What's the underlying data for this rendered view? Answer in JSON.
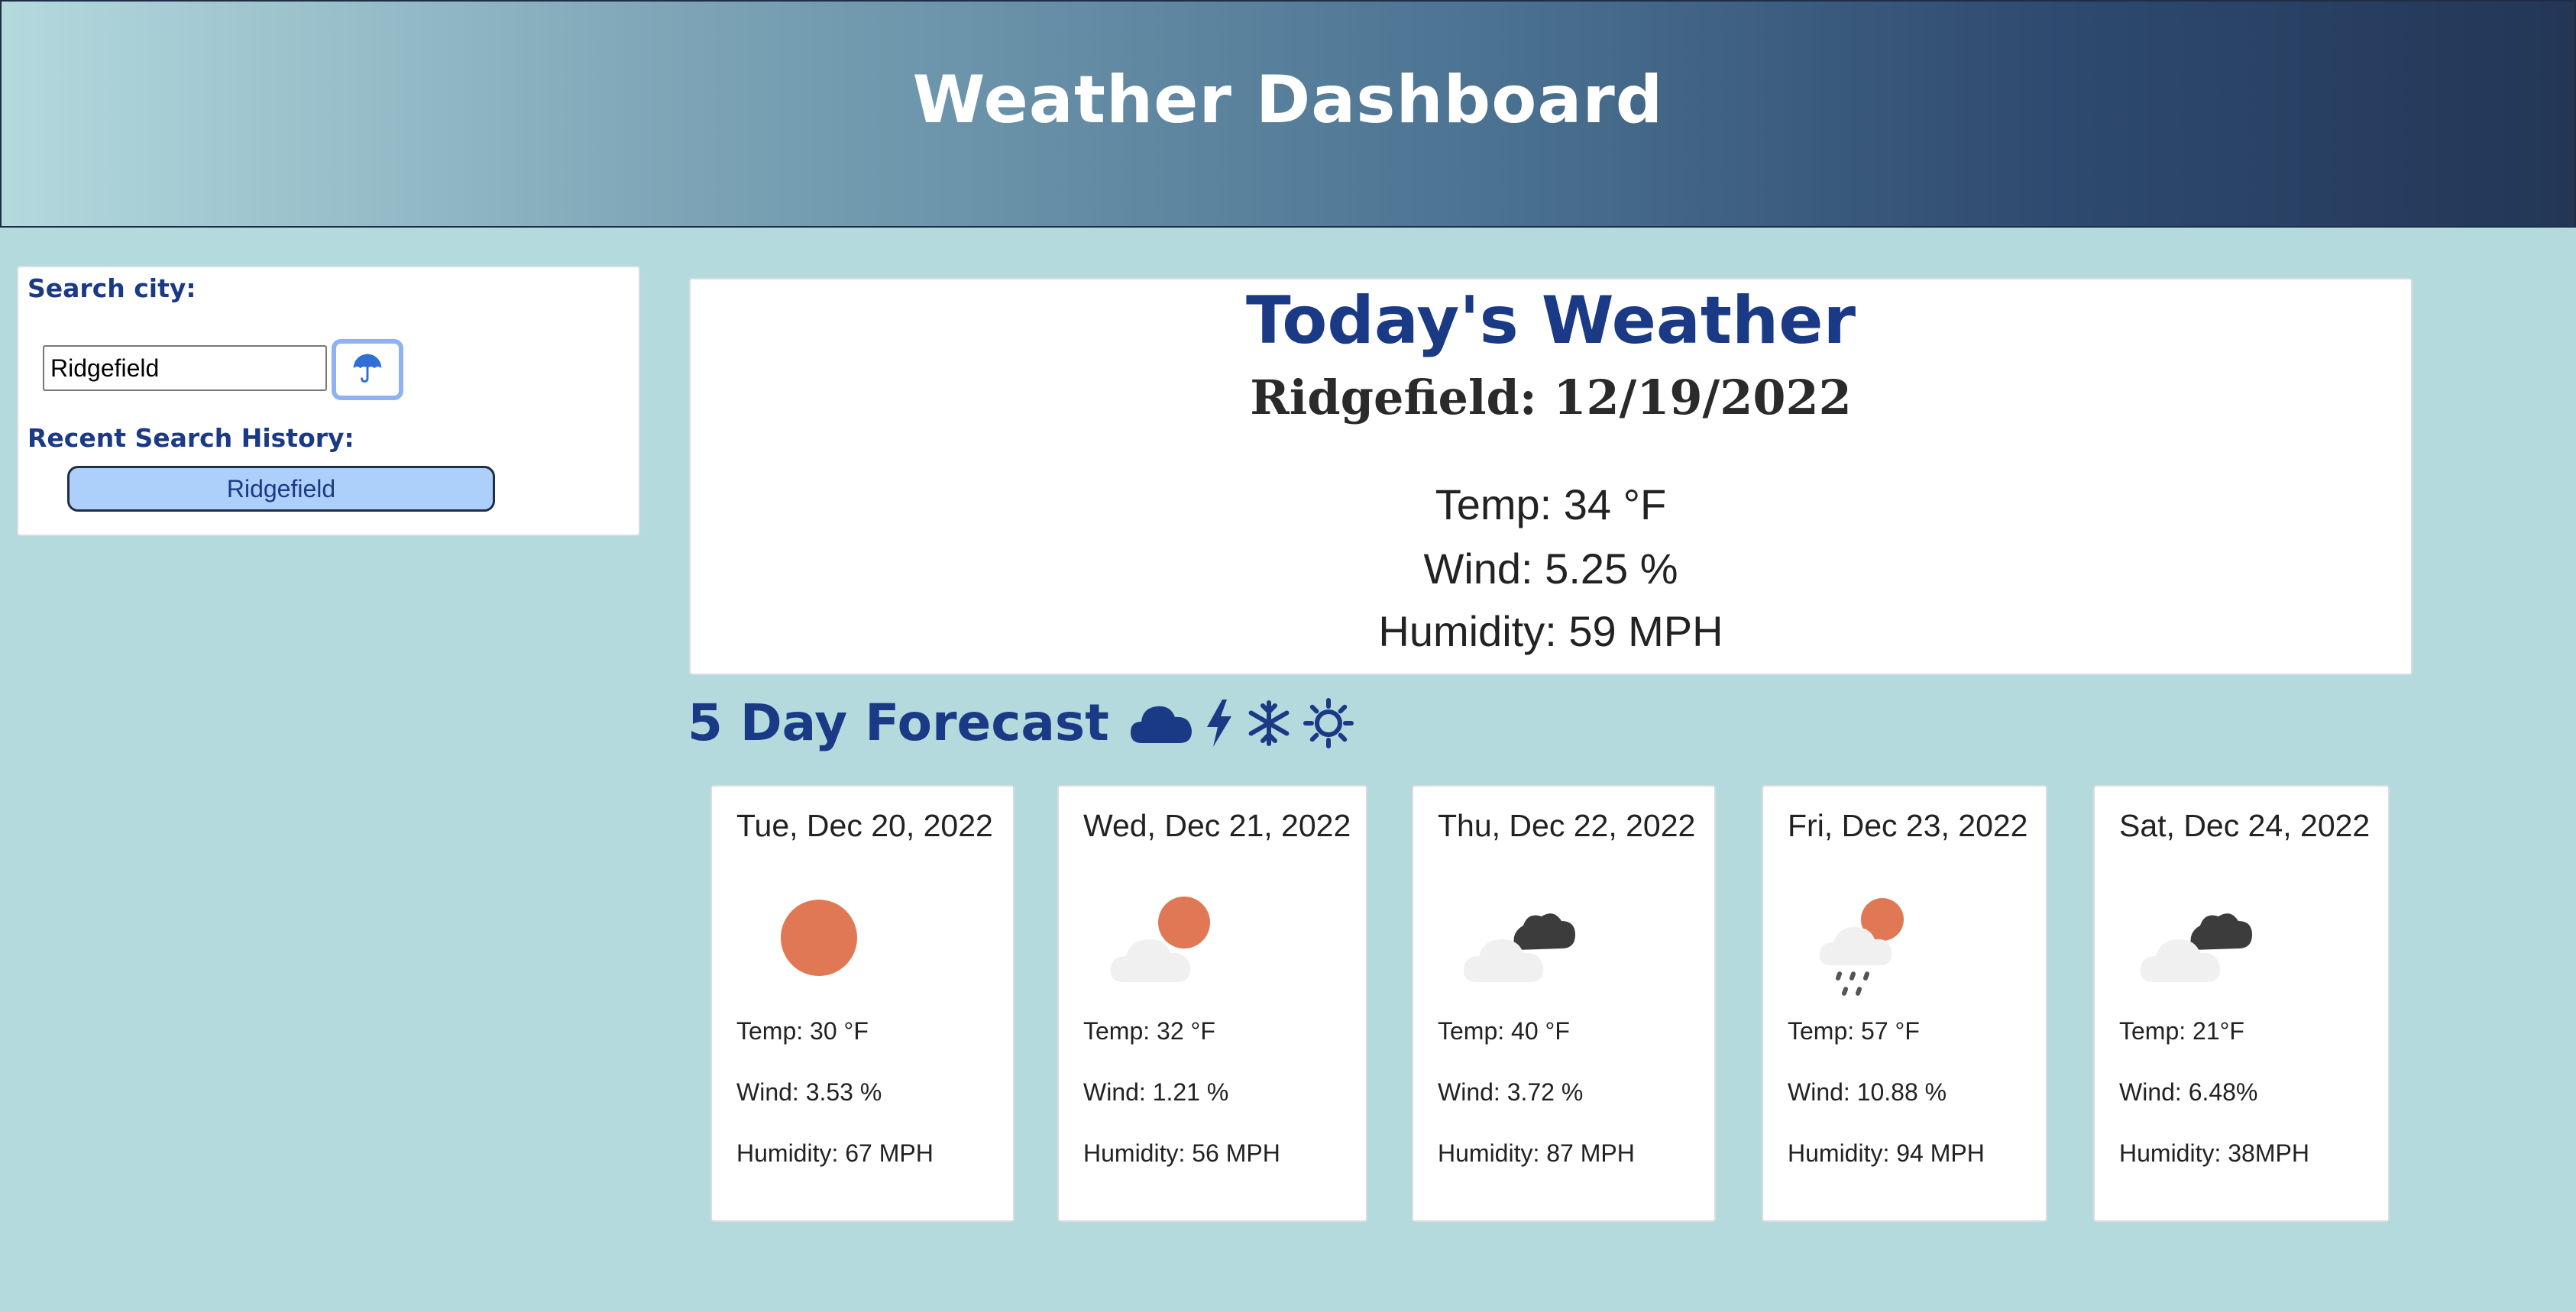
{
  "header": {
    "title": "Weather Dashboard"
  },
  "sidebar": {
    "search_label": "Search city:",
    "search_value": "Ridgefield",
    "search_button_icon": "umbrella-icon",
    "history_label": "Recent Search History:",
    "history": [
      "Ridgefield"
    ]
  },
  "today": {
    "title": "Today's Weather",
    "city_date": "Ridgefield: 12/19/2022",
    "temp": "Temp: 34 °F",
    "wind": "Wind: 5.25 %",
    "humidity": "Humidity: 59 MPH"
  },
  "forecast": {
    "heading": "5 Day Forecast",
    "heading_icons": [
      "cloud-icon",
      "lightning-icon",
      "snowflake-icon",
      "sun-icon"
    ],
    "days": [
      {
        "date": "Tue, Dec 20, 2022",
        "icon": "sun-icon",
        "temp": "Temp: 30 °F",
        "wind": "Wind: 3.53 %",
        "humidity": "Humidity: 67 MPH"
      },
      {
        "date": "Wed, Dec 21, 2022",
        "icon": "partly-cloudy-icon",
        "temp": "Temp: 32 °F",
        "wind": "Wind: 1.21 %",
        "humidity": "Humidity: 56 MPH"
      },
      {
        "date": "Thu, Dec 22, 2022",
        "icon": "cloudy-icon",
        "temp": "Temp: 40 °F",
        "wind": "Wind: 3.72 %",
        "humidity": "Humidity: 87 MPH"
      },
      {
        "date": "Fri, Dec 23, 2022",
        "icon": "rain-sun-icon",
        "temp": "Temp: 57 °F",
        "wind": "Wind: 10.88 %",
        "humidity": "Humidity: 94 MPH"
      },
      {
        "date": "Sat, Dec 24, 2022",
        "icon": "cloudy-icon",
        "temp": "Temp: 21°F",
        "wind": "Wind: 6.48%",
        "humidity": "Humidity: 38MPH"
      }
    ]
  },
  "colors": {
    "background": "#b4dade",
    "accent": "#1a3a86",
    "history_button": "#add0fb",
    "sun": "#e07856"
  }
}
